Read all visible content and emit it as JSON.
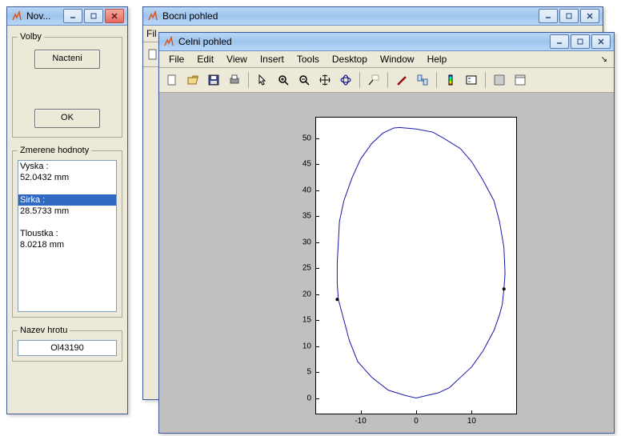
{
  "left_window": {
    "title": "Nov...",
    "groups": {
      "volby_label": "Volby",
      "nacteni_btn": "Nacteni",
      "ok_btn": "OK",
      "zmerene_label": "Zmerene hodnoty",
      "nazev_label": "Nazev hrotu",
      "nazev_value": "Ol43190"
    },
    "list": [
      {
        "text": "Vyska :",
        "sel": false
      },
      {
        "text": "52.0432 mm",
        "sel": false
      },
      {
        "text": "",
        "sel": false
      },
      {
        "text": "Sirka :",
        "sel": true
      },
      {
        "text": "28.5733 mm",
        "sel": false
      },
      {
        "text": "",
        "sel": false
      },
      {
        "text": "Tloustka :",
        "sel": false
      },
      {
        "text": "8.0218 mm",
        "sel": false
      }
    ]
  },
  "bocni_window": {
    "title": "Bocni pohled",
    "menu_stub": "Fil"
  },
  "celni_window": {
    "title": "Celni pohled",
    "menus": [
      "File",
      "Edit",
      "View",
      "Insert",
      "Tools",
      "Desktop",
      "Window",
      "Help"
    ],
    "toolbar": [
      "new",
      "open",
      "save",
      "print",
      "",
      "pointer",
      "zoom-in",
      "zoom-out",
      "pan",
      "rotate3d",
      "",
      "datacursor",
      "",
      "brush",
      "link",
      "",
      "colorbar",
      "legend",
      "",
      "hide",
      "show"
    ]
  },
  "chart_data": {
    "type": "line",
    "title": "",
    "xlabel": "",
    "ylabel": "",
    "xlim": [
      -18,
      18
    ],
    "ylim": [
      -3,
      54
    ],
    "xticks": [
      -10,
      0,
      10
    ],
    "yticks": [
      0,
      5,
      10,
      15,
      20,
      25,
      30,
      35,
      40,
      45,
      50
    ],
    "series": [
      {
        "name": "outline",
        "color": "#1518a8",
        "x": [
          -4,
          -6,
          -8,
          -10,
          -11.5,
          -13,
          -13.8,
          -14,
          -14.2,
          -14.2,
          -14,
          -13,
          -12,
          -10.5,
          -8,
          -5,
          -2,
          0,
          2,
          4,
          6,
          8,
          10,
          12,
          14,
          15,
          15.5,
          15.8,
          16,
          15.8,
          15,
          14,
          12,
          10,
          8,
          5,
          3,
          0,
          -2,
          -3,
          -4
        ],
        "y": [
          52,
          51,
          49,
          46,
          42.5,
          38,
          34,
          30,
          26,
          22,
          19,
          15,
          11,
          7,
          4,
          1.5,
          0.5,
          0,
          0.5,
          1,
          2,
          4,
          6,
          9,
          13,
          16,
          18,
          21,
          24,
          29,
          34,
          38,
          42,
          45.5,
          48,
          50,
          51.2,
          51.8,
          52,
          52.1,
          52
        ]
      }
    ],
    "markers": [
      {
        "x": -14.2,
        "y": 19,
        "shape": "dot"
      },
      {
        "x": 15.8,
        "y": 21,
        "shape": "dot"
      }
    ]
  }
}
